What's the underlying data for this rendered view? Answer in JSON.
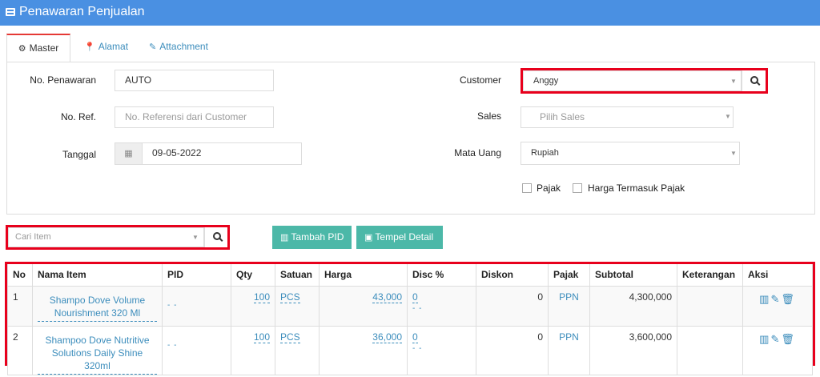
{
  "app": {
    "title": "Penawaran Penjualan"
  },
  "tabs": [
    {
      "label": "Master",
      "icon": "cogs-icon",
      "active": true
    },
    {
      "label": "Alamat",
      "icon": "map-marker-icon"
    },
    {
      "label": "Attachment",
      "icon": "paperclip-icon"
    }
  ],
  "form": {
    "no_penawaran": {
      "label": "No. Penawaran",
      "value": "AUTO"
    },
    "no_ref": {
      "label": "No. Ref.",
      "placeholder": "No. Referensi dari Customer"
    },
    "tanggal": {
      "label": "Tanggal",
      "value": "09-05-2022"
    },
    "customer": {
      "label": "Customer",
      "value": "Anggy"
    },
    "sales": {
      "label": "Sales",
      "placeholder": "Pilih Sales"
    },
    "mata_uang": {
      "label": "Mata Uang",
      "value": "Rupiah"
    },
    "pajak": {
      "label": "Pajak",
      "checked": false
    },
    "harga_termasuk_pajak": {
      "label": "Harga Termasuk Pajak",
      "checked": false
    }
  },
  "item_search": {
    "placeholder": "Cari Item"
  },
  "buttons": {
    "tambah_pid": "Tambah PID",
    "tempel_detail": "Tempel Detail"
  },
  "table": {
    "columns": [
      "No",
      "Nama Item",
      "PID",
      "Qty",
      "Satuan",
      "Harga",
      "Disc %",
      "Diskon",
      "Pajak",
      "Subtotal",
      "Keterangan",
      "Aksi"
    ],
    "rows": [
      {
        "no": "1",
        "nama_line1": "Shampo Dove Volume",
        "nama_line2": "Nourishment 320 Ml",
        "pid": "- -",
        "qty": "100",
        "satuan": "PCS",
        "harga": "43,000",
        "disc": "0",
        "disc_sub": "- -",
        "diskon": "0",
        "pajak": "PPN",
        "subtotal": "4,300,000",
        "keterangan": ""
      },
      {
        "no": "2",
        "nama_line1": "Shampoo Dove Nutritive",
        "nama_line2": "Solutions Daily Shine 320ml",
        "pid": "- -",
        "qty": "100",
        "satuan": "PCS",
        "harga": "36,000",
        "disc": "0",
        "disc_sub": "- -",
        "diskon": "0",
        "pajak": "PPN",
        "subtotal": "3,600,000",
        "keterangan": ""
      }
    ]
  },
  "colors": {
    "header": "#4a90e2",
    "accent_button": "#4cb8a8",
    "highlight": "#e8001c",
    "link": "#3c8dbc"
  }
}
